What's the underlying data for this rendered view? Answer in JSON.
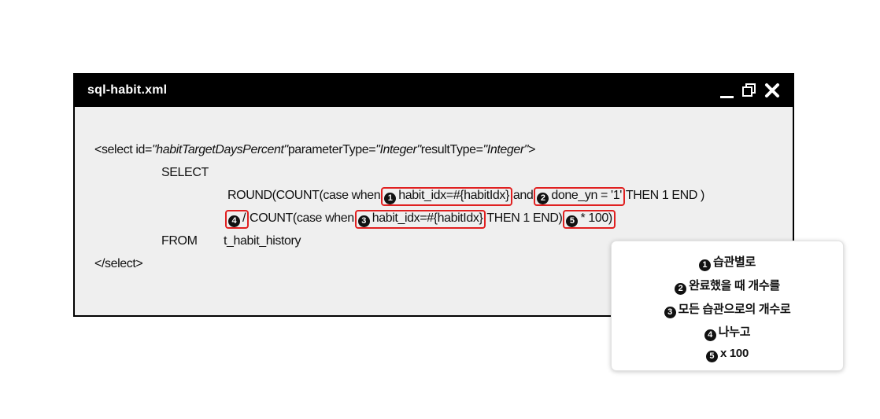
{
  "window": {
    "title": "sql-habit.xml",
    "controls": {
      "minimize_icon": "minimize-icon",
      "maximize_icon": "maximize-icon",
      "close_icon": "close-icon"
    }
  },
  "code": {
    "line1": {
      "prefix": "<select id=",
      "id_value": "\"habitTargetDaysPercent\"",
      "param_label": "parameterType=",
      "param_value": "\"Integer\"",
      "result_label": "resultType=",
      "result_value": "\"Integer\"",
      "suffix": ">"
    },
    "line2": "SELECT",
    "line3": {
      "start": "ROUND(COUNT(case when",
      "m1": "1",
      "box1": "habit_idx=#{habitIdx}",
      "and": "and",
      "m2": "2",
      "box2": "done_yn = '1'",
      "end": "THEN 1 END )"
    },
    "line4": {
      "m4": "4",
      "box4": "/",
      "mid": "COUNT(case when",
      "m3": "3",
      "box3": "habit_idx=#{habitIdx}",
      "end": "THEN 1 END)",
      "m5": "5",
      "box5": "* 100)"
    },
    "line5": {
      "keyword": "FROM",
      "table": "t_habit_history"
    },
    "line6": "</select>"
  },
  "legend": [
    {
      "marker": "1",
      "text": "습관별로"
    },
    {
      "marker": "2",
      "text": "완료했을 때 개수를"
    },
    {
      "marker": "3",
      "text": "모든 습관으로의 개수로"
    },
    {
      "marker": "4",
      "text": "나누고"
    },
    {
      "marker": "5",
      "text": "x 100"
    }
  ],
  "colors": {
    "highlight": "#e02020",
    "titlebar": "#000000",
    "code_bg": "#efefef"
  }
}
